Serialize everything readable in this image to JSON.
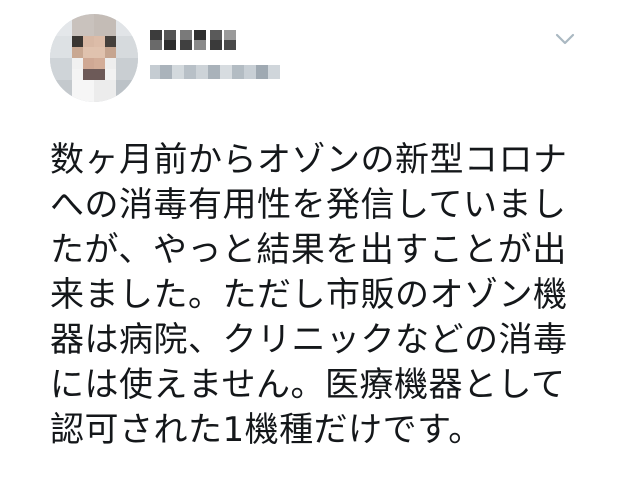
{
  "tweet": {
    "author": {
      "avatar_icon": "profile-photo-pixelated",
      "display_name_obscured": true,
      "handle_obscured": true
    },
    "menu_icon": "chevron-down-icon",
    "text_lines": [
      "数ヶ月前からオゾンの新型コロナ",
      "への消毒有用性を発信していまし",
      "たが、やっと結果を出すことが出",
      "来ました。ただし市販のオゾン機",
      "器は病院、クリニックなどの消毒",
      "には使えません。医療機器として",
      "認可された1機種だけです。"
    ]
  },
  "colors": {
    "text": "#14171a",
    "caret": "#aab8c2",
    "background": "#ffffff"
  }
}
